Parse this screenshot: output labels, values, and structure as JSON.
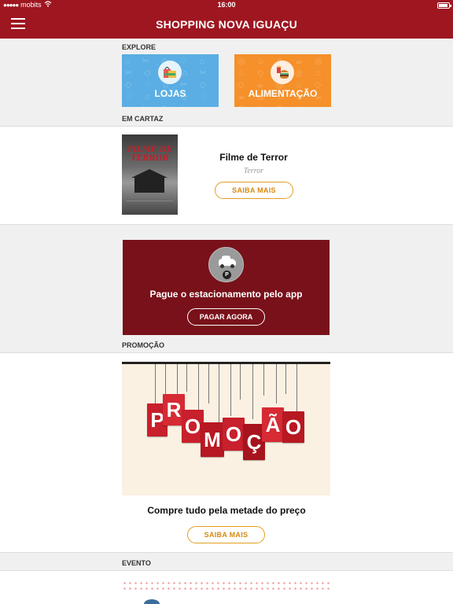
{
  "statusbar": {
    "carrier": "mobits",
    "time": "16:00"
  },
  "navbar": {
    "title": "SHOPPING NOVA IGUAÇU"
  },
  "explore": {
    "label": "EXPLORE",
    "tiles": [
      {
        "label": "LOJAS",
        "color": "#5aaee3",
        "icon": "shopping-bag-icon"
      },
      {
        "label": "ALIMENTAÇÃO",
        "color": "#f5902a",
        "icon": "burger-fries-icon"
      }
    ]
  },
  "em_cartaz": {
    "label": "EM CARTAZ",
    "poster_title": "FILME DE TERROR",
    "movie_title": "Filme de Terror",
    "genre": "Terror",
    "button": "SAIBA MAIS"
  },
  "parking": {
    "text": "Pague o estacionamento pelo app",
    "button": "PAGAR AGORA",
    "badge": "P"
  },
  "promocao": {
    "label": "PROMOÇÃO",
    "image_letters": [
      "P",
      "R",
      "O",
      "M",
      "O",
      "Ç",
      "Ã",
      "O"
    ],
    "text": "Compre tudo pela metade do preço",
    "button": "SAIBA MAIS"
  },
  "evento": {
    "label": "EVENTO"
  },
  "colors": {
    "brand": "#9e1620",
    "accent": "#e0a020",
    "parking": "#78111a"
  }
}
